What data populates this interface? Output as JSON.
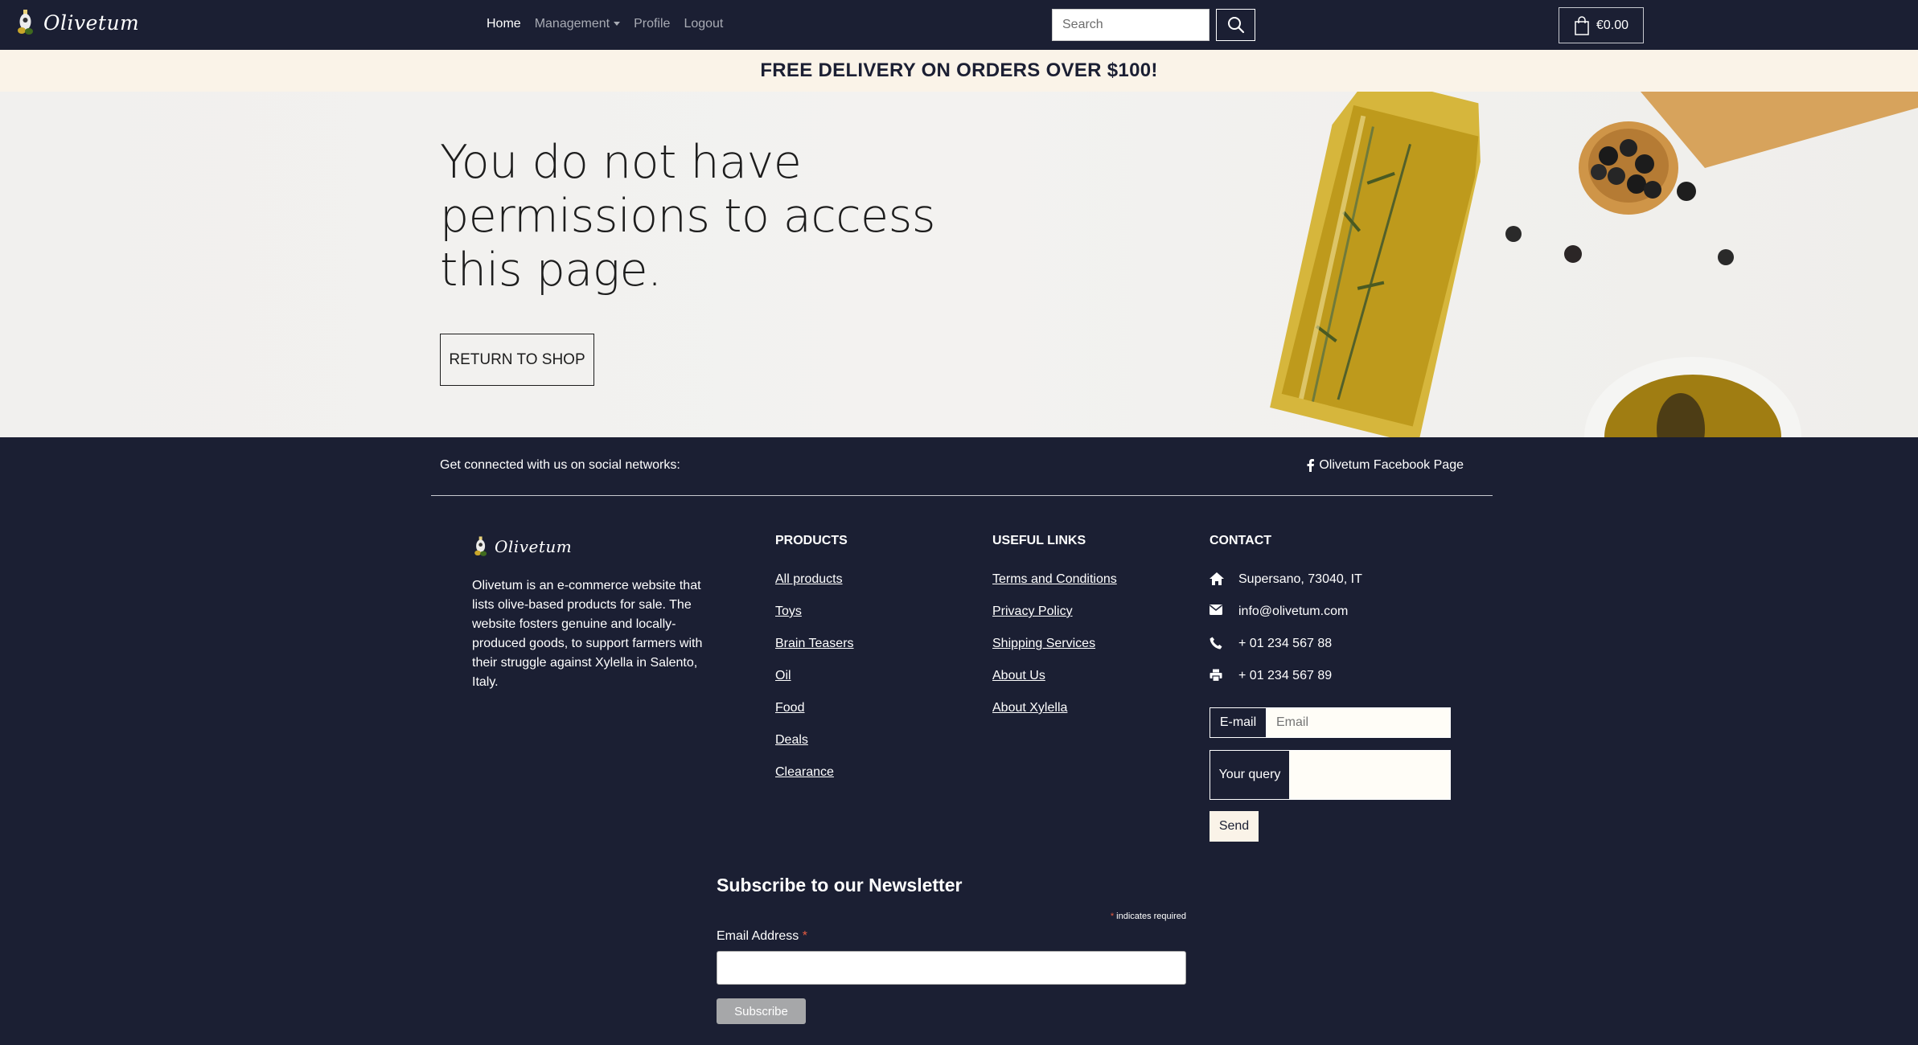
{
  "header": {
    "brand": "Olivetum",
    "nav": {
      "home": "Home",
      "management": "Management",
      "profile": "Profile",
      "logout": "Logout"
    },
    "search": {
      "placeholder": "Search"
    },
    "cart": {
      "total": "€0.00"
    }
  },
  "promo": {
    "text": "FREE DELIVERY ON ORDERS OVER $100!"
  },
  "hero": {
    "title": "You do not have permissions to access this page.",
    "button": "RETURN TO SHOP"
  },
  "footer": {
    "social": {
      "text": "Get connected with us on social networks:",
      "facebook": "Olivetum Facebook Page"
    },
    "about": {
      "brand": "Olivetum",
      "description": "Olivetum is an e-commerce website that lists olive-based products for sale. The website fosters genuine and locally-produced goods, to support farmers with their struggle against Xylella in Salento, Italy."
    },
    "products": {
      "title": "PRODUCTS",
      "links": [
        "All products",
        "Toys",
        "Brain Teasers",
        "Oil",
        "Food",
        "Deals",
        "Clearance"
      ]
    },
    "useful_links": {
      "title": "USEFUL LINKS",
      "links": [
        "Terms and Conditions",
        "Privacy Policy",
        "Shipping Services",
        "About Us",
        "About Xylella"
      ]
    },
    "contact": {
      "title": "CONTACT",
      "address": "Supersano, 73040, IT",
      "email": "info@olivetum.com",
      "phone": "+ 01 234 567 88",
      "fax": "+ 01 234 567 89",
      "email_label": "E-mail",
      "email_placeholder": "Email",
      "query_label": "Your query",
      "send": "Send"
    },
    "newsletter": {
      "title": "Subscribe to our Newsletter",
      "required_note": "indicates required",
      "email_label": "Email Address",
      "button": "Subscribe"
    }
  }
}
